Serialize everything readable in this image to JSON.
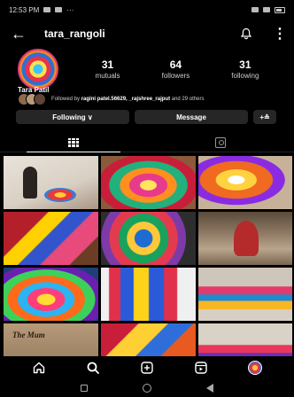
{
  "status_bar": {
    "time": "12:53 PM",
    "dots": "···"
  },
  "header": {
    "username": "tara_rangoli"
  },
  "profile": {
    "stats": [
      {
        "value": "31",
        "label": "mutuals"
      },
      {
        "value": "64",
        "label": "followers"
      },
      {
        "value": "31",
        "label": "following"
      }
    ],
    "display_name": "Tara Patil",
    "followed_by_prefix": "Followed by ",
    "followed_by_names": "ragini patel.56629, _rajshree_rajput",
    "followed_by_suffix": " and 29 others"
  },
  "actions": {
    "following_label": "Following",
    "following_chevron": "∨",
    "message_label": "Message",
    "add_label": "+≗"
  },
  "tabs": [
    {
      "icon": "grid-icon",
      "active": true
    },
    {
      "icon": "tagged-icon",
      "active": false
    }
  ],
  "posts": [
    "post-1",
    "post-2",
    "post-3",
    "post-4",
    "post-5",
    "post-6",
    "post-7",
    "post-8",
    "post-9",
    "post-10",
    "post-11",
    "post-12"
  ],
  "colors": {
    "background": "#000000",
    "button_bg": "#262626",
    "avatar_ring": "#e03b76"
  }
}
